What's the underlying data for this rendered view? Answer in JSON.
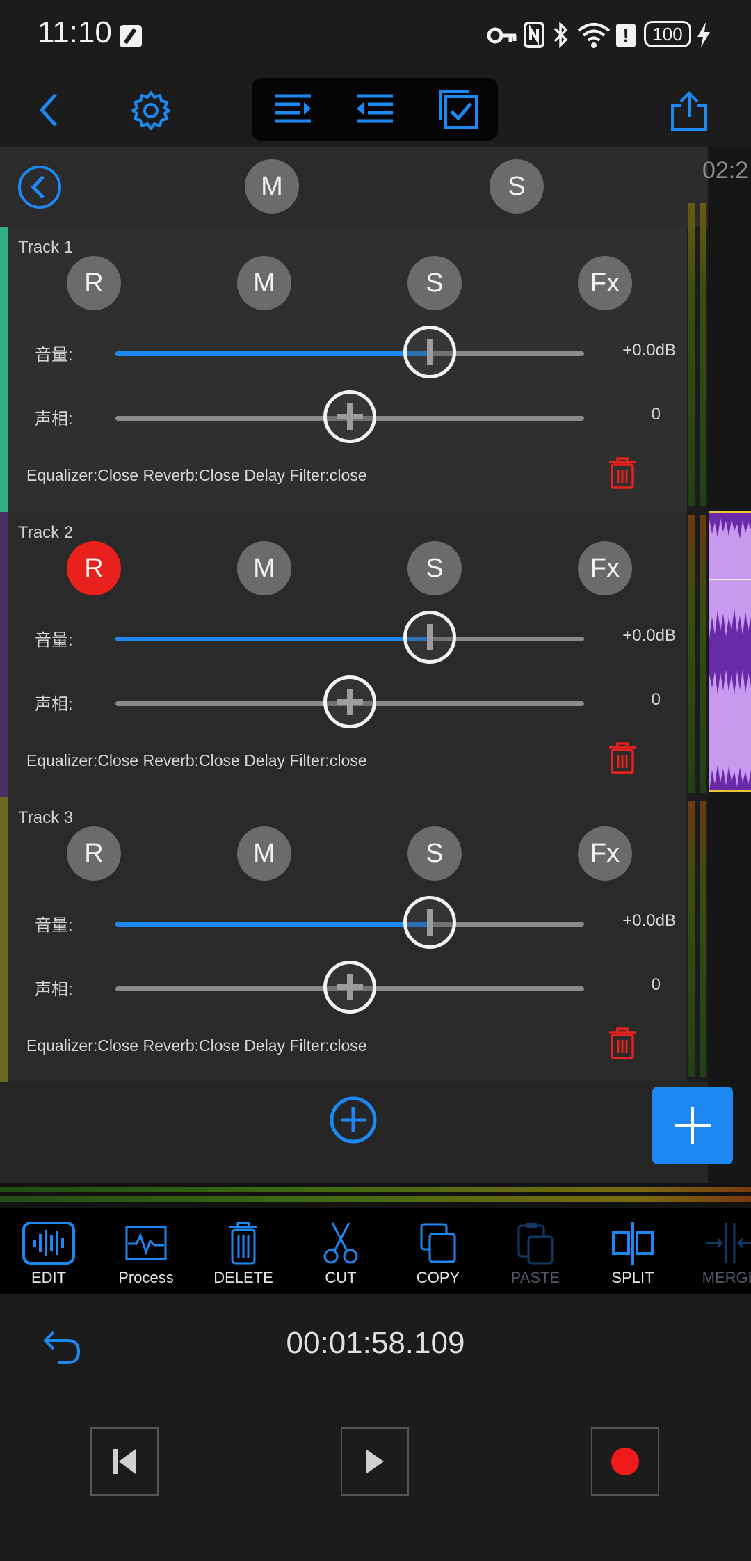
{
  "status_bar": {
    "time": "11:10",
    "battery": "100"
  },
  "header": {
    "mute_all_label": "M",
    "solo_all_label": "S",
    "time_marker": "02:2"
  },
  "tracks": [
    {
      "name": "Track 1",
      "record_label": "R",
      "mute_label": "M",
      "solo_label": "S",
      "fx_label": "Fx",
      "record_active": false,
      "color": "#2fae87",
      "volume_label": "音量:",
      "volume_value": "+0.0dB",
      "volume_fraction": 0.67,
      "pan_label": "声相:",
      "pan_value": "0",
      "pan_fraction": 0.5,
      "effects": "Equalizer:Close Reverb:Close Delay Filter:close"
    },
    {
      "name": "Track 2",
      "record_label": "R",
      "mute_label": "M",
      "solo_label": "S",
      "fx_label": "Fx",
      "record_active": true,
      "color": "#4a2e66",
      "volume_label": "音量:",
      "volume_value": "+0.0dB",
      "volume_fraction": 0.67,
      "pan_label": "声相:",
      "pan_value": "0",
      "pan_fraction": 0.5,
      "effects": "Equalizer:Close Reverb:Close Delay Filter:close"
    },
    {
      "name": "Track 3",
      "record_label": "R",
      "mute_label": "M",
      "solo_label": "S",
      "fx_label": "Fx",
      "record_active": false,
      "color": "#6b6a25",
      "volume_label": "音量:",
      "volume_value": "+0.0dB",
      "volume_fraction": 0.67,
      "pan_label": "声相:",
      "pan_value": "0",
      "pan_fraction": 0.5,
      "effects": "Equalizer:Close Reverb:Close Delay Filter:close"
    }
  ],
  "edit_tools": [
    {
      "label": "EDIT",
      "icon": "waveform-icon",
      "enabled": true
    },
    {
      "label": "Process",
      "icon": "process-icon",
      "enabled": true
    },
    {
      "label": "DELETE",
      "icon": "trash-icon",
      "enabled": true
    },
    {
      "label": "CUT",
      "icon": "scissors-icon",
      "enabled": true
    },
    {
      "label": "COPY",
      "icon": "copy-icon",
      "enabled": true
    },
    {
      "label": "PASTE",
      "icon": "paste-icon",
      "enabled": false
    },
    {
      "label": "SPLIT",
      "icon": "split-icon",
      "enabled": true
    },
    {
      "label": "MERGE",
      "icon": "merge-icon",
      "enabled": false
    }
  ],
  "transport": {
    "time": "00:01:58.109"
  },
  "colors": {
    "accent": "#1e88f2",
    "record": "#e8211c",
    "delete": "#e8211c"
  }
}
